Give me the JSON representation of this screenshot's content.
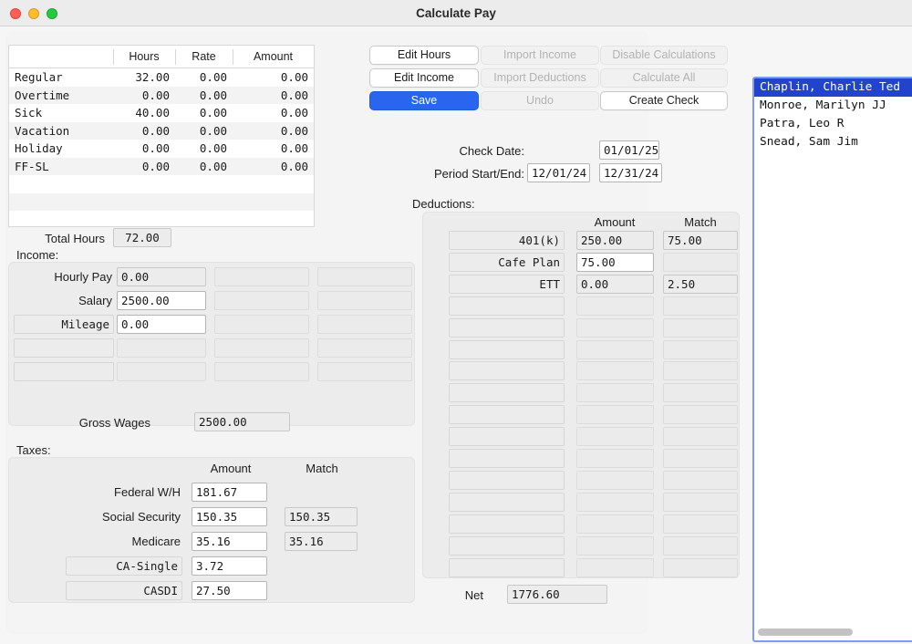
{
  "window": {
    "title": "Calculate Pay",
    "traffic_lights": [
      "close-button",
      "minimize-button",
      "zoom-button"
    ]
  },
  "hours_table": {
    "columns": [
      "",
      "Hours",
      "Rate",
      "Amount"
    ],
    "rows": [
      {
        "name": "Regular",
        "hours": "32.00",
        "rate": "0.00",
        "amount": "0.00"
      },
      {
        "name": "Overtime",
        "hours": "0.00",
        "rate": "0.00",
        "amount": "0.00"
      },
      {
        "name": "Sick",
        "hours": "40.00",
        "rate": "0.00",
        "amount": "0.00"
      },
      {
        "name": "Vacation",
        "hours": "0.00",
        "rate": "0.00",
        "amount": "0.00"
      },
      {
        "name": "Holiday",
        "hours": "0.00",
        "rate": "0.00",
        "amount": "0.00"
      },
      {
        "name": "FF-SL",
        "hours": "0.00",
        "rate": "0.00",
        "amount": "0.00"
      },
      {
        "name": "",
        "hours": "",
        "rate": "",
        "amount": ""
      },
      {
        "name": "",
        "hours": "",
        "rate": "",
        "amount": ""
      },
      {
        "name": "",
        "hours": "",
        "rate": "",
        "amount": ""
      }
    ]
  },
  "totals": {
    "total_hours_label": "Total Hours",
    "total_hours_value": "72.00",
    "gross_wages_label": "Gross Wages",
    "gross_wages_value": "2500.00",
    "net_label": "Net",
    "net_value": "1776.60"
  },
  "income": {
    "section_label": "Income:",
    "rows": [
      {
        "label": "Hourly Pay",
        "label_boxed": false,
        "value": "0.00",
        "value_white": false
      },
      {
        "label": "Salary",
        "label_boxed": false,
        "value": "2500.00",
        "value_white": true
      },
      {
        "label": "Mileage",
        "label_boxed": true,
        "value": "0.00",
        "value_white": true
      },
      {
        "label": "",
        "label_boxed": true,
        "value": "",
        "value_white": false
      },
      {
        "label": "",
        "label_boxed": true,
        "value": "",
        "value_white": false
      }
    ],
    "extra_columns": 2
  },
  "taxes": {
    "section_label": "Taxes:",
    "col_amount": "Amount",
    "col_match": "Match",
    "rows": [
      {
        "label": "Federal W/H",
        "label_boxed": false,
        "amount": "181.67",
        "match": ""
      },
      {
        "label": "Social Security",
        "label_boxed": false,
        "amount": "150.35",
        "match": "150.35"
      },
      {
        "label": "Medicare",
        "label_boxed": false,
        "amount": "35.16",
        "match": "35.16"
      },
      {
        "label": "CA-Single",
        "label_boxed": true,
        "amount": "3.72",
        "match": ""
      },
      {
        "label": "CASDI",
        "label_boxed": true,
        "amount": "27.50",
        "match": ""
      }
    ]
  },
  "toolbar": {
    "buttons": [
      {
        "label": "Edit Hours",
        "state": "normal"
      },
      {
        "label": "Import Income",
        "state": "disabled"
      },
      {
        "label": "Disable Calculations",
        "state": "disabled"
      },
      {
        "label": "Edit Income",
        "state": "normal"
      },
      {
        "label": "Import Deductions",
        "state": "disabled"
      },
      {
        "label": "Calculate All",
        "state": "disabled"
      },
      {
        "label": "Save",
        "state": "primary"
      },
      {
        "label": "Undo",
        "state": "disabled"
      },
      {
        "label": "Create Check",
        "state": "normal"
      }
    ]
  },
  "dates": {
    "check_date_label": "Check Date:",
    "check_date_value": "01/01/25",
    "period_label": "Period Start/End:",
    "period_start_value": "12/01/24",
    "period_end_value": "12/31/24"
  },
  "deductions": {
    "section_label": "Deductions:",
    "col_amount": "Amount",
    "col_match": "Match",
    "rows": [
      {
        "label": "401(k)",
        "amount": "250.00",
        "match": "75.00",
        "amount_white": false
      },
      {
        "label": "Cafe Plan",
        "amount": "75.00",
        "match": "",
        "amount_white": true
      },
      {
        "label": "ETT",
        "amount": "0.00",
        "match": "2.50",
        "amount_white": false
      },
      {
        "label": "",
        "amount": "",
        "match": "",
        "amount_white": false
      },
      {
        "label": "",
        "amount": "",
        "match": "",
        "amount_white": false
      },
      {
        "label": "",
        "amount": "",
        "match": "",
        "amount_white": false
      },
      {
        "label": "",
        "amount": "",
        "match": "",
        "amount_white": false
      },
      {
        "label": "",
        "amount": "",
        "match": "",
        "amount_white": false
      },
      {
        "label": "",
        "amount": "",
        "match": "",
        "amount_white": false
      },
      {
        "label": "",
        "amount": "",
        "match": "",
        "amount_white": false
      },
      {
        "label": "",
        "amount": "",
        "match": "",
        "amount_white": false
      },
      {
        "label": "",
        "amount": "",
        "match": "",
        "amount_white": false
      },
      {
        "label": "",
        "amount": "",
        "match": "",
        "amount_white": false
      },
      {
        "label": "",
        "amount": "",
        "match": "",
        "amount_white": false
      },
      {
        "label": "",
        "amount": "",
        "match": "",
        "amount_white": false
      },
      {
        "label": "",
        "amount": "",
        "match": "",
        "amount_white": false
      }
    ]
  },
  "employee_list": {
    "items": [
      {
        "name": "Chaplin, Charlie Ted",
        "selected": true
      },
      {
        "name": "Monroe, Marilyn JJ",
        "selected": false
      },
      {
        "name": "Patra, Leo R",
        "selected": false
      },
      {
        "name": "Snead, Sam Jim",
        "selected": false
      }
    ],
    "scrollbar": "horizontal-scrollbar"
  },
  "colors": {
    "accent_blue": "#2a65f0",
    "selection_blue": "#2244cc",
    "list_focus_border": "#7e9df0",
    "window_bg": "#f6f6f6"
  }
}
